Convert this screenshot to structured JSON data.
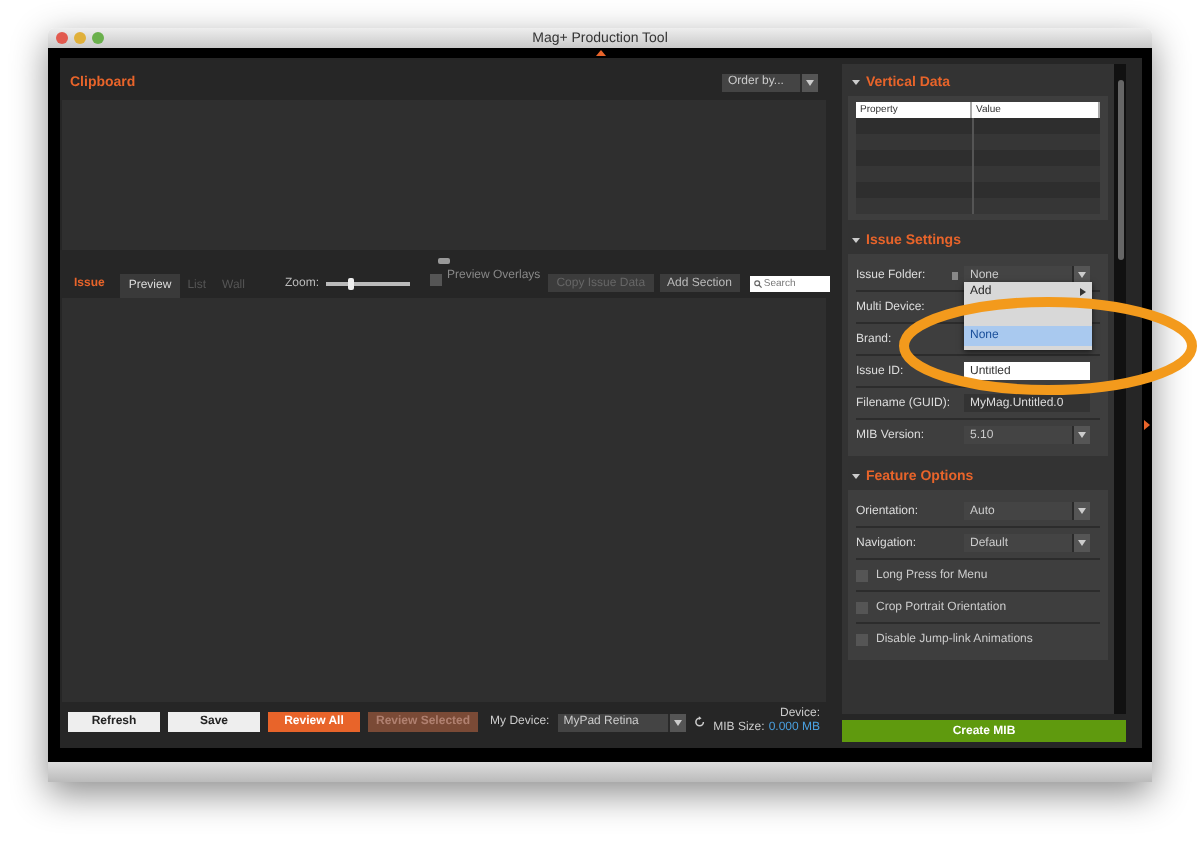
{
  "window": {
    "title": "Mag+ Production Tool"
  },
  "clipboard": {
    "title": "Clipboard",
    "order_by": "Order by..."
  },
  "issue_toolbar": {
    "title": "Issue",
    "tabs": [
      {
        "label": "Preview",
        "selected": true
      },
      {
        "label": "List",
        "selected": false
      },
      {
        "label": "Wall",
        "selected": false
      }
    ],
    "zoom_label": "Zoom:",
    "zoom": {
      "level": 0.3
    },
    "preview_overlays": {
      "label": "Preview Overlays",
      "checked": false
    },
    "buttons": [
      {
        "label": "Copy Issue Data",
        "disabled": true
      },
      {
        "label": "Add Section",
        "disabled": false
      }
    ],
    "search": {
      "placeholder": "Search"
    }
  },
  "bottom_bar": {
    "buttons": [
      {
        "label": "Refresh",
        "kind": "plain"
      },
      {
        "label": "Save",
        "kind": "plain"
      },
      {
        "label": "Review All",
        "kind": "accent",
        "disabled": false
      },
      {
        "label": "Review Selected",
        "kind": "accent",
        "disabled": true
      }
    ],
    "device_label": "My Device:",
    "device": "MyPad Retina",
    "device_caption": "Device:",
    "mib_size_label": "MIB Size:",
    "mib_size": "0.000 MB"
  },
  "sections": [
    {
      "title": "Vertical Data",
      "expanded": true,
      "kind": "table",
      "columns": [
        "Property",
        "Value"
      ]
    },
    {
      "title": "Issue Settings",
      "expanded": true,
      "kind": "form",
      "fields": [
        {
          "label": "Issue Folder:",
          "kind": "select",
          "value": "None",
          "popup": [
            {
              "label": "Add",
              "selected": false
            },
            {
              "label": "None",
              "selected": true
            }
          ]
        },
        {
          "label": "Multi Device:",
          "kind": "covered"
        },
        {
          "label": "Brand:",
          "kind": "covered"
        },
        {
          "label": "Issue ID:",
          "kind": "input",
          "value": "Untitled"
        },
        {
          "label": "Filename (GUID):",
          "kind": "readonly",
          "value": "MyMag.Untitled.0"
        },
        {
          "label": "MIB Version:",
          "kind": "select",
          "value": "5.10"
        }
      ]
    },
    {
      "title": "Feature Options",
      "expanded": true,
      "kind": "form",
      "fields": [
        {
          "label": "Orientation:",
          "kind": "select",
          "value": "Auto"
        },
        {
          "label": "Navigation:",
          "kind": "select",
          "value": "Default"
        },
        {
          "label": "Long Press for Menu",
          "kind": "checkbox",
          "checked": false
        },
        {
          "label": "Crop Portrait Orientation",
          "kind": "checkbox",
          "checked": false
        },
        {
          "label": "Disable Jump-link Animations",
          "kind": "checkbox",
          "checked": false
        }
      ]
    }
  ],
  "create_button": "Create MIB"
}
